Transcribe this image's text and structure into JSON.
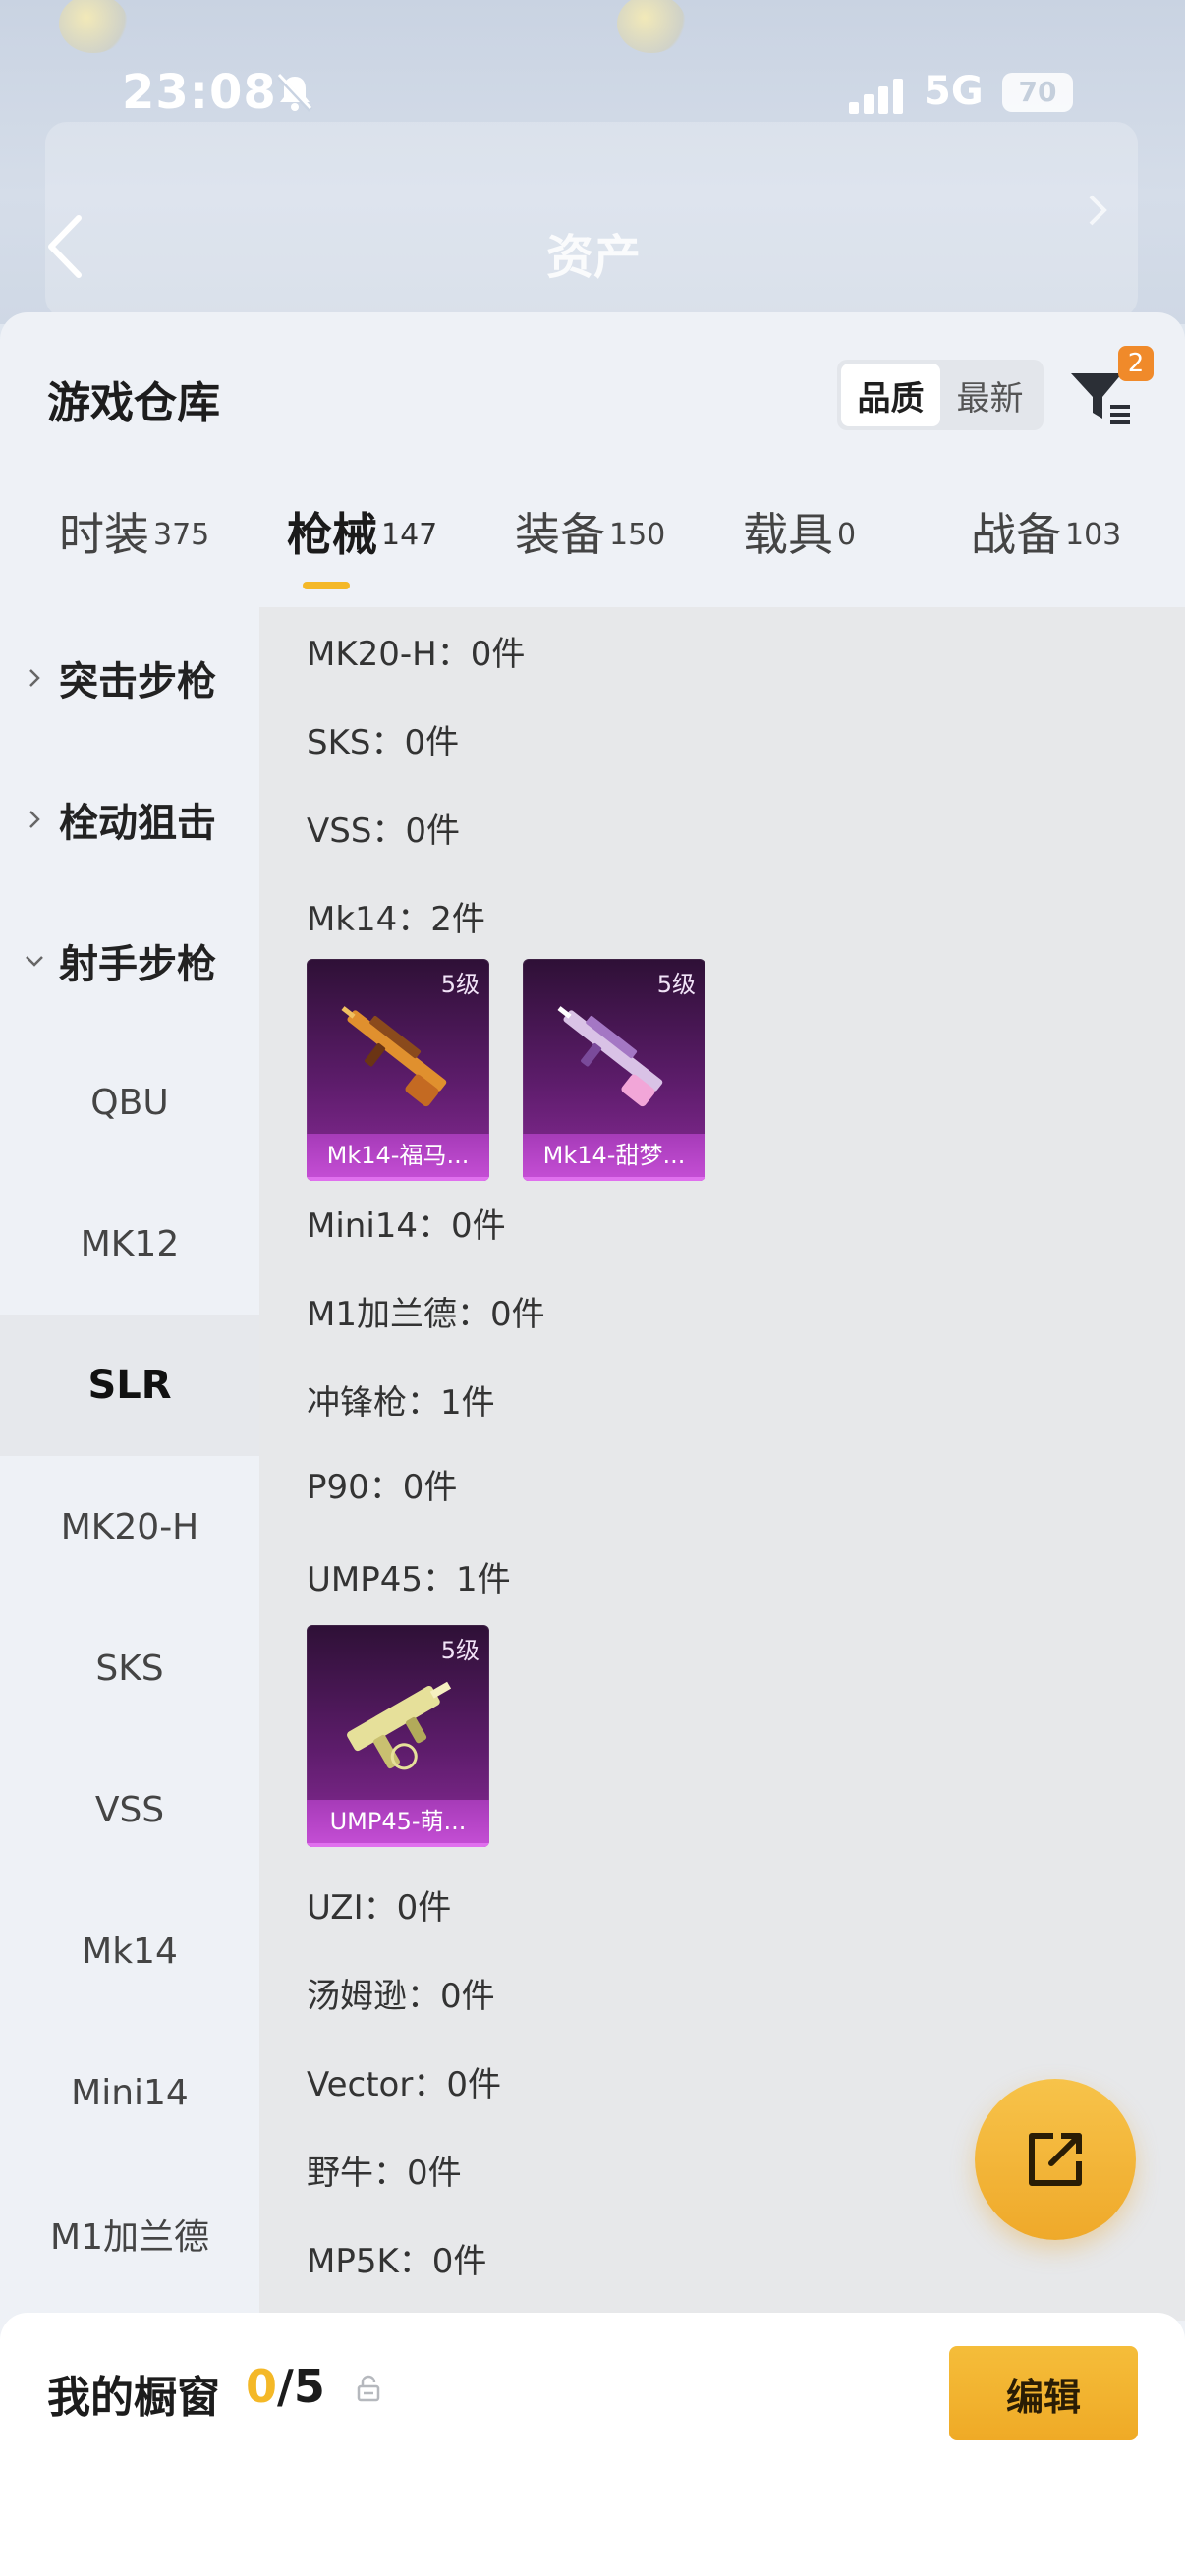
{
  "status_bar": {
    "time": "23:08",
    "network": "5G",
    "battery": "70"
  },
  "background": {
    "title": "资产"
  },
  "sheet": {
    "title": "游戏仓库",
    "sort_options": [
      "品质",
      "最新"
    ],
    "filter_badge": "2"
  },
  "category_tabs": [
    {
      "label": "时装",
      "count": "375"
    },
    {
      "label": "枪械",
      "count": "147"
    },
    {
      "label": "装备",
      "count": "150"
    },
    {
      "label": "载具",
      "count": "0"
    },
    {
      "label": "战备",
      "count": "103"
    }
  ],
  "subnav": {
    "groups": [
      "突击步枪",
      "栓动狙击",
      "射手步枪"
    ],
    "items": [
      "QBU",
      "MK12",
      "SLR",
      "MK20-H",
      "SKS",
      "VSS",
      "Mk14",
      "Mini14",
      "M1加兰德"
    ],
    "active_item": "SLR"
  },
  "content": {
    "rows": [
      "MK20-H：0件",
      "SKS：0件",
      "VSS：0件",
      "Mk14：2件",
      "Mini14：0件",
      "M1加兰德：0件",
      "冲锋枪：1件",
      "P90：0件",
      "UMP45：1件",
      "UZI：0件",
      "汤姆逊：0件",
      "Vector：0件",
      "野牛：0件",
      "MP5K：0件"
    ],
    "items": [
      {
        "grade": "5级",
        "name": "Mk14-福马..."
      },
      {
        "grade": "5级",
        "name": "Mk14-甜梦..."
      },
      {
        "grade": "5级",
        "name": "UMP45-萌..."
      }
    ]
  },
  "showcase": {
    "title": "我的橱窗",
    "used": "0",
    "slash": "/",
    "total": "5",
    "edit_label": "编辑"
  },
  "colors": {
    "accent": "#f4b827",
    "item_purple": "#8a2b98",
    "badge_orange": "#f08a2a"
  },
  "icons": [
    "back-arrow-icon",
    "bell-off-icon",
    "signal-icon",
    "filter-icon",
    "chevron-right-icon",
    "chevron-down-icon",
    "share-icon",
    "lock-icon"
  ]
}
